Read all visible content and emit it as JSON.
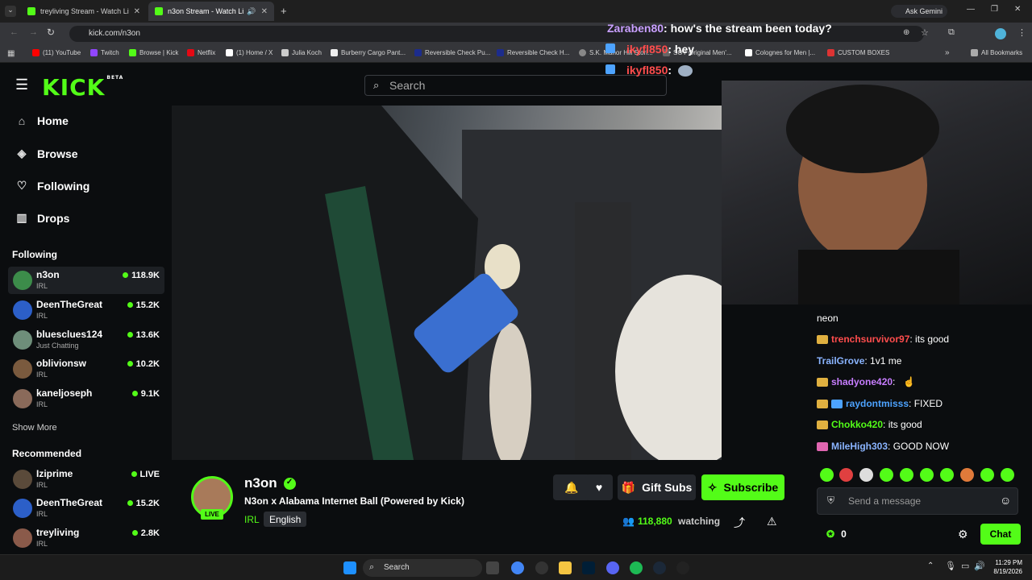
{
  "browser": {
    "tabs": [
      {
        "title": "treyliving Stream - Watch Live o"
      },
      {
        "title": "n3on Stream - Watch Live o"
      }
    ],
    "url": "kick.com/n3on",
    "ask_gemini": "Ask Gemini",
    "bookmarks": [
      {
        "label": "(11) YouTube",
        "color": "#ff0000"
      },
      {
        "label": "Twitch",
        "color": "#9146ff"
      },
      {
        "label": "Browse | Kick",
        "color": "#53fc18"
      },
      {
        "label": "Netflix",
        "color": "#e50914"
      },
      {
        "label": "(1) Home / X",
        "color": "#ffffff"
      },
      {
        "label": "Julia Koch",
        "color": "#cccccc"
      },
      {
        "label": "Burberry Cargo Pant...",
        "color": "#eeeeee"
      },
      {
        "label": "Reversible Check Pu...",
        "color": "#1c2c8c"
      },
      {
        "label": "Reversible Check H...",
        "color": "#1c2c8c"
      },
      {
        "label": "S.K. Manor Hill Stori...",
        "color": "#888888"
      },
      {
        "label": "SOY Original Men'...",
        "color": "#666666"
      },
      {
        "label": "Colognes for Men |...",
        "color": "#ffffff"
      },
      {
        "label": "CUSTOM BOXES",
        "color": "#d33"
      }
    ],
    "all_bookmarks": "All Bookmarks"
  },
  "kick": {
    "logo": "KICK",
    "logo_badge": "BETA",
    "search_placeholder": "Search"
  },
  "sidebar": {
    "nav": [
      {
        "label": "Home",
        "icon": "home-icon"
      },
      {
        "label": "Browse",
        "icon": "browse-icon"
      },
      {
        "label": "Following",
        "icon": "heart-icon"
      },
      {
        "label": "Drops",
        "icon": "drops-icon"
      }
    ],
    "following_title": "Following",
    "following": [
      {
        "name": "n3on",
        "category": "IRL",
        "viewers": "118.9K"
      },
      {
        "name": "DeenTheGreat",
        "category": "IRL",
        "viewers": "15.2K"
      },
      {
        "name": "bluesclues124",
        "category": "Just Chatting",
        "viewers": "13.6K"
      },
      {
        "name": "oblivionsw",
        "category": "IRL",
        "viewers": "10.2K"
      },
      {
        "name": "kaneljoseph",
        "category": "IRL",
        "viewers": "9.1K"
      }
    ],
    "show_more": "Show More",
    "recommended_title": "Recommended",
    "recommended": [
      {
        "name": "Iziprime",
        "category": "IRL",
        "viewers": "LIVE"
      },
      {
        "name": "DeenTheGreat",
        "category": "IRL",
        "viewers": "15.2K"
      },
      {
        "name": "treyliving",
        "category": "IRL",
        "viewers": "2.8K"
      }
    ]
  },
  "overlay_chat": [
    {
      "user": "Zaraben80",
      "text": ": how's the stream been today?",
      "color": "#c9a0ff"
    },
    {
      "user": "ikyfl850",
      "text": ": hey",
      "color": "#ff4d4d"
    },
    {
      "user": "ikyfl850",
      "text": ":",
      "color": "#ff4d4d"
    }
  ],
  "stream": {
    "channel": "n3on",
    "title": "N3on x Alabama Internet Ball (Powered by Kick)",
    "category": "IRL",
    "language": "English",
    "live_badge": "LIVE",
    "viewers": "118,880",
    "watching_label": "watching",
    "gift_subs": "Gift Subs",
    "subscribe": "Subscribe"
  },
  "chat": {
    "messages": [
      {
        "user": "",
        "text": "neon",
        "color": "#ffffff"
      },
      {
        "user": "trenchsurvivor97",
        "text": ": its good",
        "color": "#ff4d4d"
      },
      {
        "user": "TrailGrove",
        "text": ": 1v1 me",
        "color": "#8ab4ff"
      },
      {
        "user": "shadyone420",
        "text": ":",
        "color": "#c77dff"
      },
      {
        "user": "raydontmisss",
        "text": ": FIXED",
        "color": "#4da3ff"
      },
      {
        "user": "Chokko420",
        "text": ": its good",
        "color": "#53fc18"
      },
      {
        "user": "MileHigh303",
        "text": ": GOOD NOW",
        "color": "#8ab4ff"
      }
    ],
    "placeholder": "Send a message",
    "points": "0",
    "chat_button": "Chat"
  },
  "taskbar": {
    "search": "Search",
    "time": "11:29 PM",
    "date": "8/19/2026"
  }
}
